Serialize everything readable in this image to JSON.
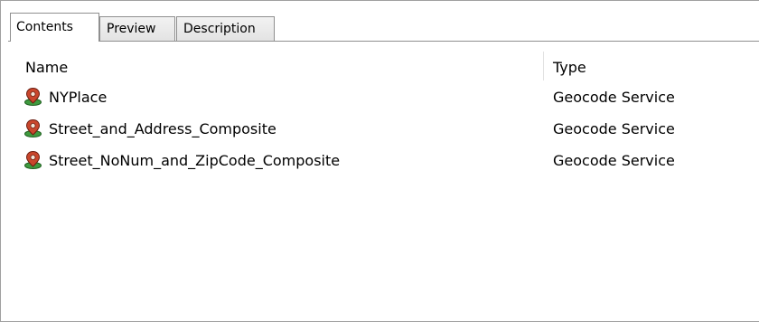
{
  "tabs": [
    {
      "label": "Contents",
      "active": true
    },
    {
      "label": "Preview",
      "active": false
    },
    {
      "label": "Description",
      "active": false
    }
  ],
  "columns": {
    "name": "Name",
    "type": "Type"
  },
  "items": [
    {
      "name": "NYPlace",
      "type": "Geocode Service",
      "icon": "geocode-service-icon"
    },
    {
      "name": "Street_and_Address_Composite",
      "type": "Geocode Service",
      "icon": "geocode-service-icon"
    },
    {
      "name": "Street_NoNum_and_ZipCode_Composite",
      "type": "Geocode Service",
      "icon": "geocode-service-icon"
    }
  ],
  "colors": {
    "icon_red": "#c0392b",
    "icon_green": "#2e8b3a",
    "icon_dark": "#4a4a4a",
    "border": "#8f8f8f"
  }
}
